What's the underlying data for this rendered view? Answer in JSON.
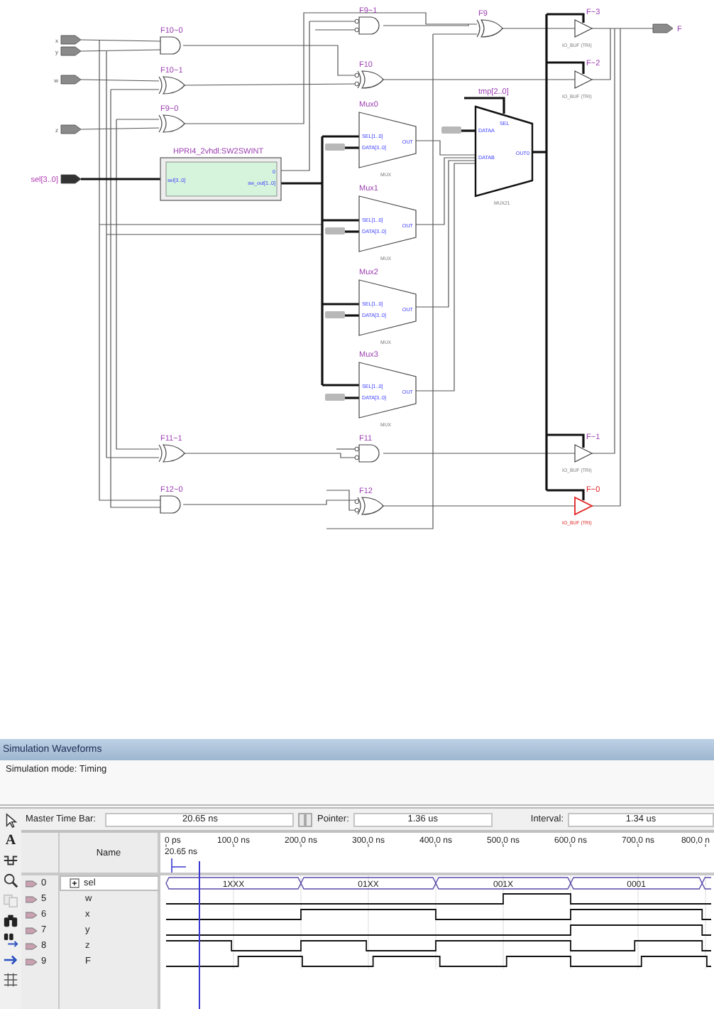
{
  "schematic": {
    "input_pins": [
      {
        "label": "x",
        "kind": "bit"
      },
      {
        "label": "y",
        "kind": "bit"
      },
      {
        "label": "w",
        "kind": "bit"
      },
      {
        "label": "z",
        "kind": "bit"
      },
      {
        "label": "sel[3..0]",
        "kind": "bus"
      }
    ],
    "gates": [
      {
        "label": "F9~1",
        "kind": "and",
        "negated_inputs": true
      },
      {
        "label": "F9",
        "kind": "xor",
        "negated_inputs": false
      },
      {
        "label": "F10~0",
        "kind": "and",
        "negated_inputs": false
      },
      {
        "label": "F10",
        "kind": "xor",
        "negated_inputs": true
      },
      {
        "label": "F10~1",
        "kind": "xor",
        "negated_inputs": false
      },
      {
        "label": "F9~0",
        "kind": "xor",
        "negated_inputs": false
      },
      {
        "label": "F11~1",
        "kind": "xor",
        "negated_inputs": false
      },
      {
        "label": "F11",
        "kind": "and",
        "negated_inputs": true
      },
      {
        "label": "F12~0",
        "kind": "and",
        "negated_inputs": false
      },
      {
        "label": "F12",
        "kind": "xor",
        "negated_inputs": true
      }
    ],
    "encoder": {
      "title": "HPRI4_2vhdl:SW2SWINT",
      "input": "sel[3..0]",
      "outputs": [
        "0",
        "sw_out[1..0]"
      ]
    },
    "muxes": [
      {
        "label": "Mux0",
        "ports": [
          "SEL[1..0]",
          "DATA[3..0]",
          "OUT"
        ],
        "type": "MUX"
      },
      {
        "label": "Mux1",
        "ports": [
          "SEL[1..0]",
          "DATA[3..0]",
          "OUT"
        ],
        "type": "MUX"
      },
      {
        "label": "Mux2",
        "ports": [
          "SEL[1..0]",
          "DATA[3..0]",
          "OUT"
        ],
        "type": "MUX"
      },
      {
        "label": "Mux3",
        "ports": [
          "SEL[1..0]",
          "DATA[3..0]",
          "OUT"
        ],
        "type": "MUX"
      }
    ],
    "mux21": {
      "label": "tmp[2..0]",
      "ports": [
        "SEL",
        "DATAA",
        "DATAB",
        "OUT0"
      ],
      "type": "MUX21"
    },
    "buffers": [
      {
        "label": "F~3",
        "type": "IO_BUF (TRI)",
        "selected": false
      },
      {
        "label": "F~2",
        "type": "IO_BUF (TRI)",
        "selected": false
      },
      {
        "label": "F~1",
        "type": "IO_BUF (TRI)",
        "selected": false
      },
      {
        "label": "F~0",
        "type": "IO_BUF (TRI)",
        "selected": true
      }
    ],
    "output_pin": {
      "label": "F"
    }
  },
  "waveform": {
    "title": "Simulation Waveforms",
    "mode": "Simulation mode: Timing",
    "tools": [
      {
        "kind": "pointer",
        "disabled": false
      },
      {
        "kind": "text",
        "glyph": "A",
        "disabled": false
      },
      {
        "kind": "wave-edit",
        "disabled": false
      },
      {
        "kind": "zoom",
        "disabled": false
      },
      {
        "kind": "copy",
        "disabled": true
      },
      {
        "kind": "find",
        "disabled": false
      },
      {
        "kind": "find-next",
        "disabled": false
      },
      {
        "kind": "next-transition",
        "disabled": false
      },
      {
        "kind": "grid",
        "disabled": false
      }
    ],
    "master_time_bar": {
      "label": "Master Time Bar:",
      "value": "20.65 ns"
    },
    "pointer": {
      "label": "Pointer:",
      "value": "1.36 us"
    },
    "interval": {
      "label": "Interval:",
      "value": "1.34 us"
    },
    "name_header": "Name",
    "time_ticks": [
      "0 ps",
      "100,0 ns",
      "200,0 ns",
      "300,0 ns",
      "400,0 ns",
      "500,0 ns",
      "600,0 ns",
      "700,0 ns",
      "800,0 n"
    ],
    "cursor_label": "20.65 ns",
    "signals": [
      {
        "index": "0",
        "name": "sel",
        "kind": "bus",
        "expanded": false,
        "selected": true,
        "segments": [
          {
            "value": "1XXX"
          },
          {
            "value": "01XX"
          },
          {
            "value": "001X"
          },
          {
            "value": "0001"
          }
        ]
      },
      {
        "index": "5",
        "name": "w",
        "kind": "bit",
        "selected": false
      },
      {
        "index": "6",
        "name": "x",
        "kind": "bit",
        "selected": false
      },
      {
        "index": "7",
        "name": "y",
        "kind": "bit",
        "selected": false
      },
      {
        "index": "8",
        "name": "z",
        "kind": "bit",
        "selected": false
      },
      {
        "index": "9",
        "name": "F",
        "kind": "bit",
        "selected": false
      }
    ]
  }
}
